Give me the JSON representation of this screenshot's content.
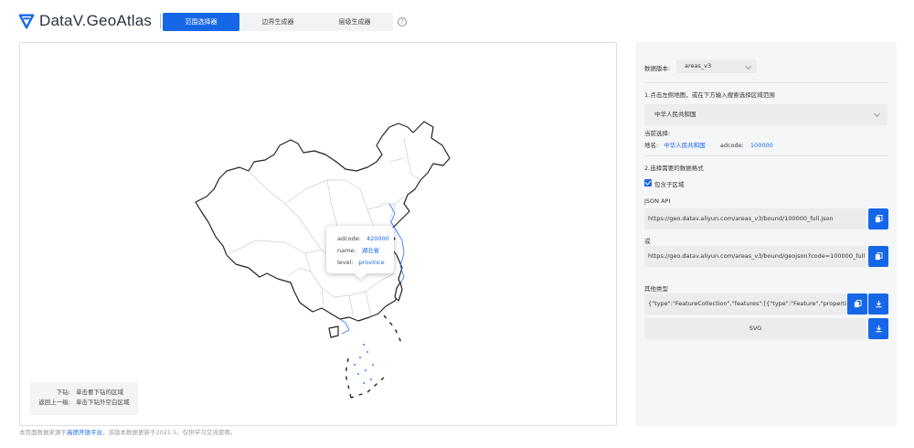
{
  "app": {
    "brand": "DataV.GeoAtlas",
    "tabs": [
      {
        "label": "范围选择器",
        "active": true
      },
      {
        "label": "边界生成器",
        "active": false
      },
      {
        "label": "层级生成器",
        "active": false
      }
    ],
    "help_glyph": "?"
  },
  "map": {
    "highlight_color": "#3b82f6",
    "tooltip": {
      "adcode_key": "adcode:",
      "adcode_val": "420000",
      "name_key": "name:",
      "name_val": "湖北省",
      "level_key": "level:",
      "level_val": "province"
    },
    "legend": {
      "drill_key": "下钻:",
      "drill_val": "单击要下钻的区域",
      "back_key": "返回上一级:",
      "back_val": "单击下钻外空白区域"
    }
  },
  "footnote": {
    "prefix": "本页面数据来源于",
    "link": "高德开放平台",
    "suffix": "，该版本数据更新于2021.5，仅供学习交流使用。"
  },
  "side": {
    "version_label": "数据版本:",
    "version_value": "areas_v3",
    "step1": "1.点击左侧地图，或在下方输入搜索选择区域范围",
    "region_value": "中华人民共和国",
    "current_label": "当前选择:",
    "place_key": "地名:",
    "place_val": "中华人民共和国",
    "adcode_key": "adcode:",
    "adcode_val": "100000",
    "step2": "2.选择需要的数据格式",
    "include_sub": "包含子区域",
    "include_sub_checked": true,
    "json_api_label": "JSON API",
    "json_api_url": "https://geo.datav.aliyun.com/areas_v3/bound/100000_full.json",
    "or_label": "或",
    "geojson_url": "https://geo.datav.aliyun.com/areas_v3/bound/geojson?code=100000_full",
    "other_label": "其他类型",
    "geojson_preview": "{\"type\":\"FeatureCollection\",\"features\":[{\"type\":\"Feature\",\"properties",
    "svg_label": "SVG",
    "icons": {
      "copy": "copy-icon",
      "download": "download-icon"
    },
    "accent": "#1667e8"
  }
}
